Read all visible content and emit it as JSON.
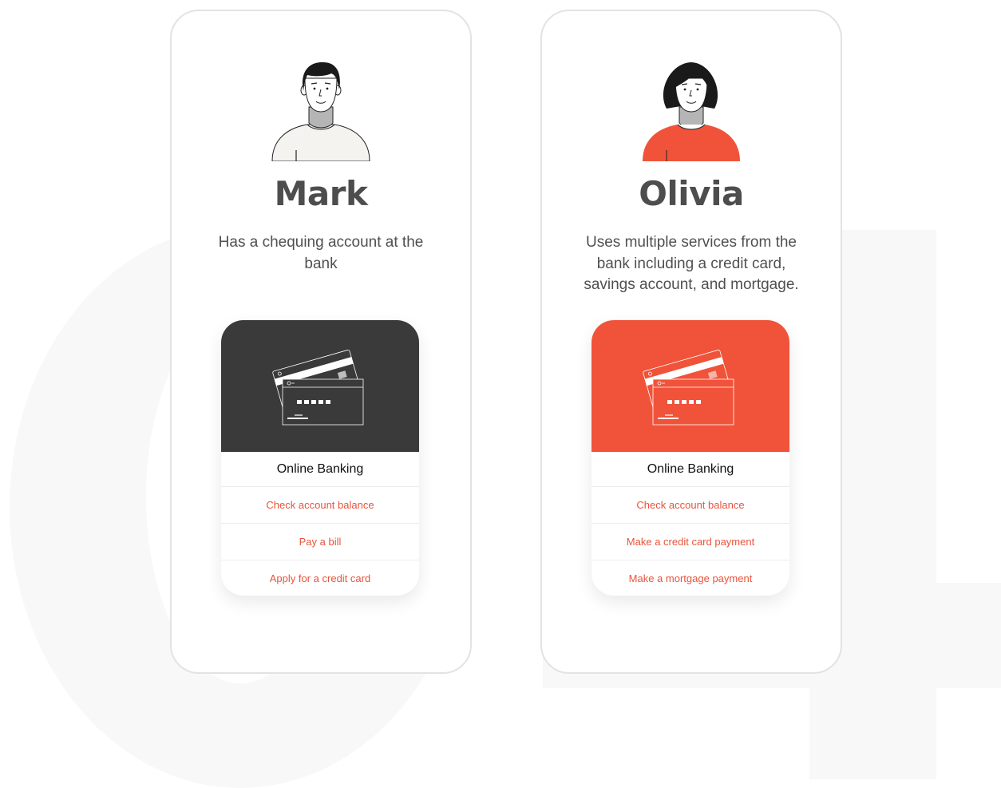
{
  "accent_color": "#f0533a",
  "dark_color": "#3a3a3a",
  "personas": [
    {
      "name": "Mark",
      "description": "Has a chequing account at the bank",
      "avatar_icon": "man-avatar-icon",
      "card": {
        "hero_icon": "credit-cards-icon",
        "title": "Online Banking",
        "actions": [
          "Check account balance",
          "Pay a bill",
          "Apply for a credit card"
        ]
      }
    },
    {
      "name": "Olivia",
      "description": "Uses multiple services from the bank including a credit card, savings account, and mortgage.",
      "avatar_icon": "woman-avatar-icon",
      "card": {
        "hero_icon": "credit-cards-icon",
        "title": "Online Banking",
        "actions": [
          "Check account balance",
          "Make a credit card payment",
          "Make a mortgage payment"
        ]
      }
    }
  ]
}
